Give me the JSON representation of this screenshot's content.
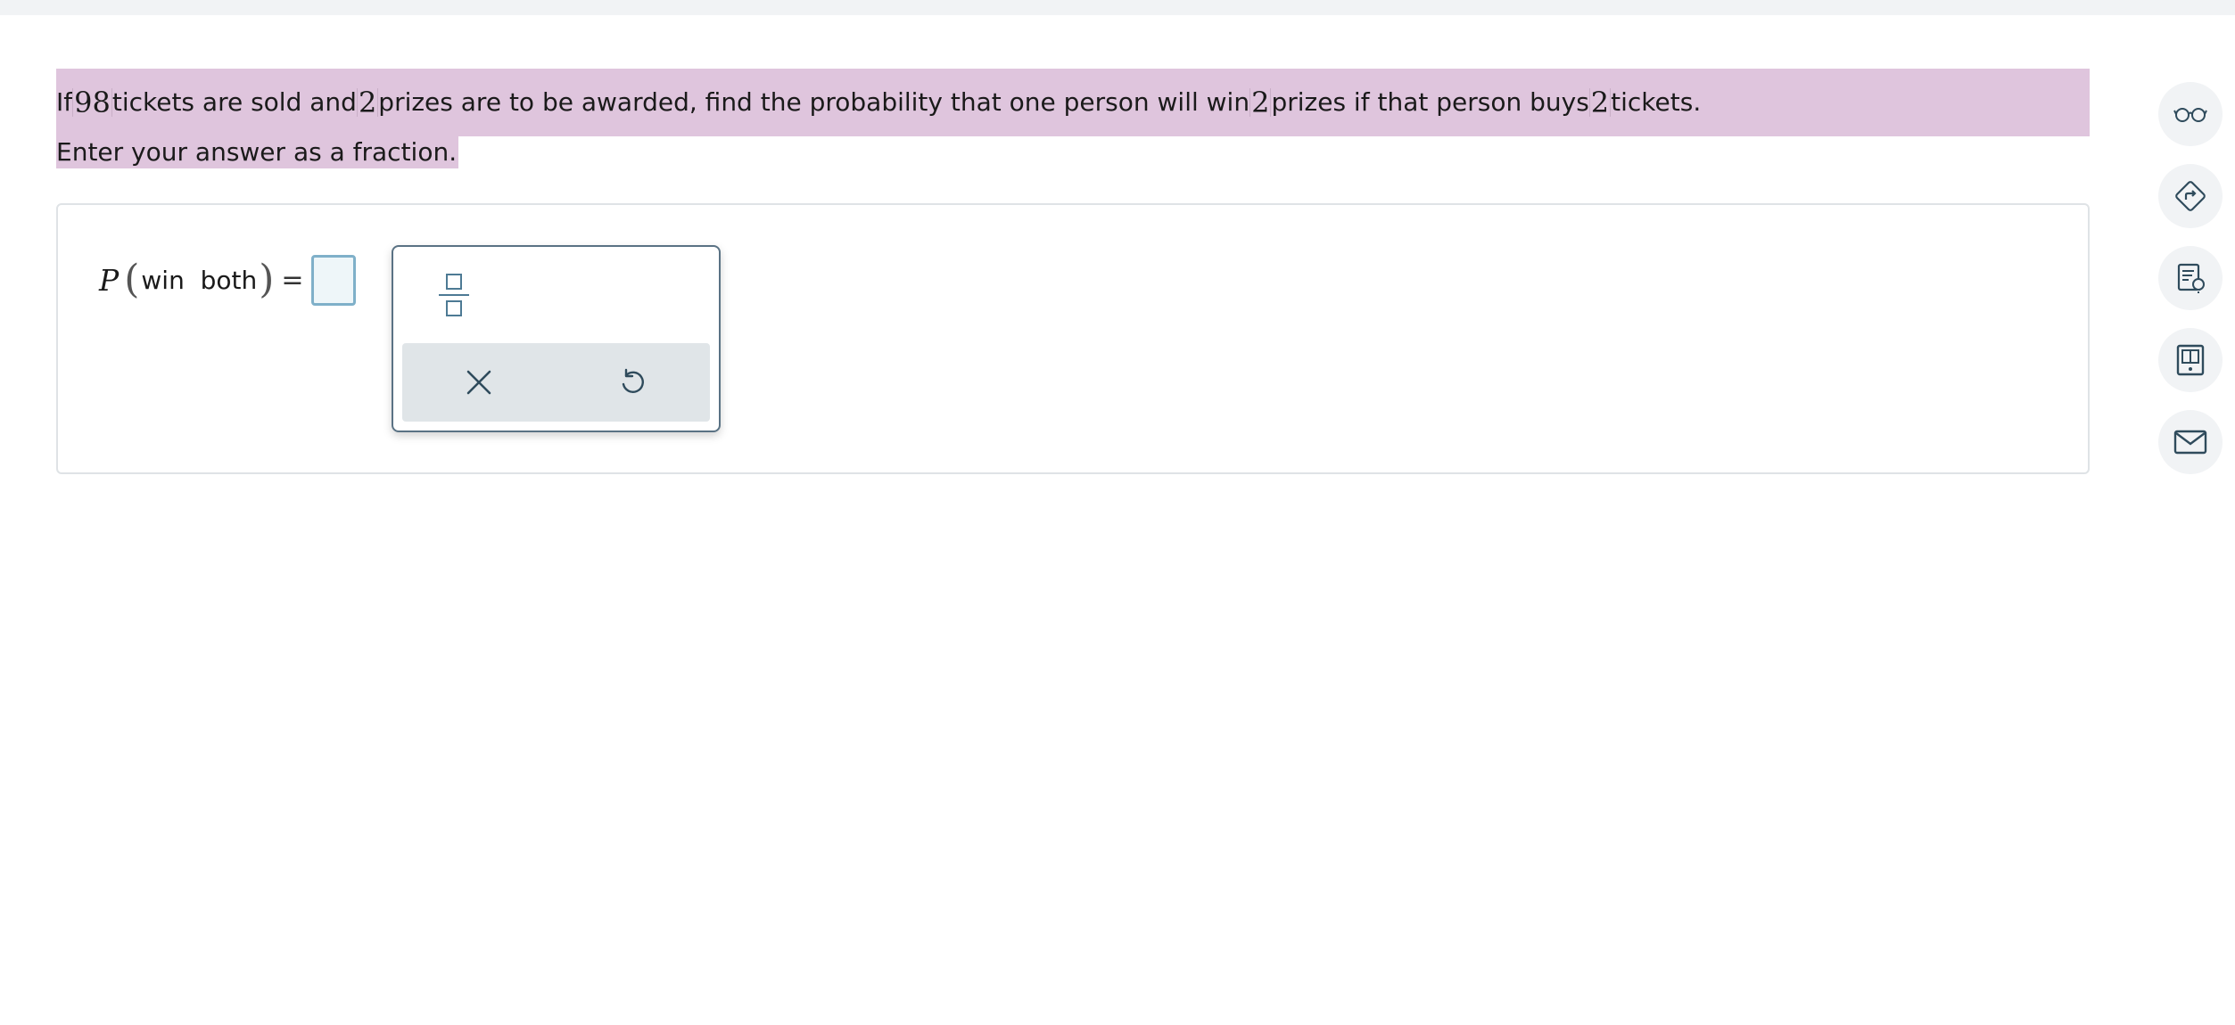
{
  "question": {
    "line1": {
      "t1": "If ",
      "n1": "98",
      "t2": " tickets are sold and ",
      "n2": "2",
      "t3": " prizes are to be awarded, find the probability that one person will win ",
      "n3": "2",
      "t4": " prizes if that person buys ",
      "n4": "2",
      "t5": " tickets."
    },
    "line2": "Enter your answer as a fraction."
  },
  "answer": {
    "variable": "P",
    "open_paren": "(",
    "event": "win  both",
    "close_paren": ")",
    "equals": "=",
    "value": ""
  },
  "palette": {
    "buttons": [
      "fraction-icon",
      "clear-icon",
      "undo-icon"
    ]
  },
  "side_tools": [
    "glasses-icon",
    "directions-icon",
    "checklist-lightbulb-icon",
    "textbook-icon",
    "mail-icon"
  ],
  "colors": {
    "highlight": "#dfc5dd",
    "input_border": "#7fb0c9",
    "icon": "#2f4b5c",
    "palette_footer": "#e0e5e8"
  }
}
